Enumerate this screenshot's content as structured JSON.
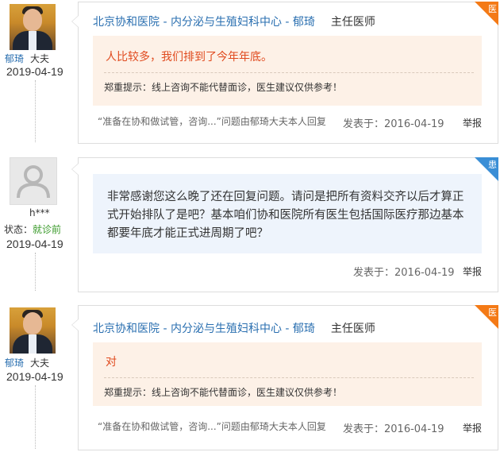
{
  "entries": [
    {
      "type": "doctor",
      "doctor_name": "郁琦",
      "doctor_title_suffix": "大夫",
      "date": "2019-04-19",
      "header_link": "北京协和医院 - 内分泌与生殖妇科中心 - 郁琦",
      "header_role": "主任医师",
      "badge": "医",
      "answer": "人比较多，我们排到了今年年底。",
      "tip": "郑重提示：线上咨询不能代替面诊，医生建议仅供参考！",
      "quote": "“准备在协和做试管，咨询...”问题由郁琦大夫本人回复",
      "posted_label": "发表于：",
      "posted_date": "2016-04-19",
      "report": "举报"
    },
    {
      "type": "patient",
      "patient_name": "h***",
      "status_label": "状态：",
      "status_value": "就诊前",
      "date": "2019-04-19",
      "badge": "患",
      "question": "非常感谢您这么晚了还在回复问题。请问是把所有资料交齐以后才算正式开始排队了是吧？基本咱们协和医院所有医生包括国际医疗那边基本都要年底才能正式进周期了吧？",
      "posted_label": "发表于：",
      "posted_date": "2016-04-19",
      "report": "举报"
    },
    {
      "type": "doctor",
      "doctor_name": "郁琦",
      "doctor_title_suffix": "大夫",
      "date": "2019-04-19",
      "header_link": "北京协和医院 - 内分泌与生殖妇科中心 - 郁琦",
      "header_role": "主任医师",
      "badge": "医",
      "answer": "对",
      "tip": "郑重提示：线上咨询不能代替面诊，医生建议仅供参考！",
      "quote": "“准备在协和做试管，咨询...”问题由郁琦大夫本人回复",
      "posted_label": "发表于：",
      "posted_date": "2016-04-19",
      "report": "举报"
    }
  ],
  "colors": {
    "doctor_badge": "#f47a16",
    "patient_badge": "#3a8ed6",
    "link": "#2a6fb0",
    "answer_text": "#e04a1e",
    "status_green": "#3a9a2a"
  }
}
